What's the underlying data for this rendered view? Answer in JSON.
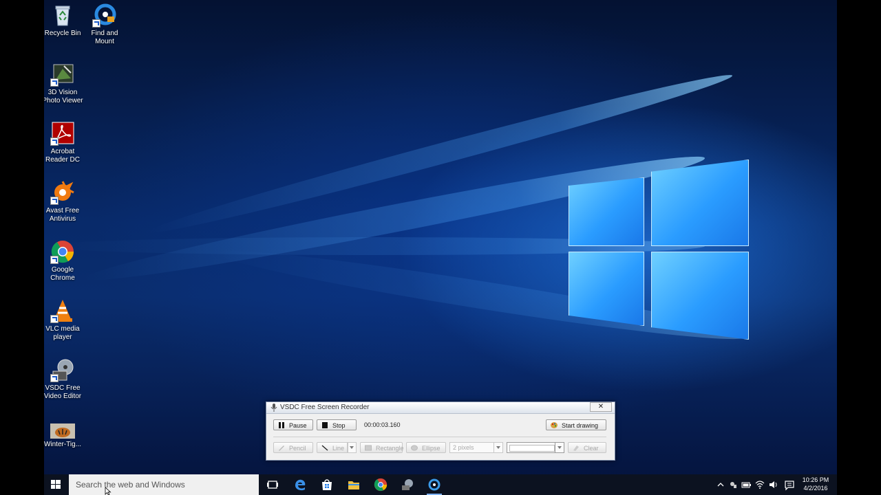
{
  "desktop_icons": [
    {
      "label": "Recycle Bin",
      "icon": "recycle-bin-icon"
    },
    {
      "label": "Find and\nMount",
      "icon": "find-and-mount-icon"
    },
    {
      "label": "3D Vision\nPhoto Viewer",
      "icon": "3d-vision-icon"
    },
    {
      "label": "Acrobat\nReader DC",
      "icon": "acrobat-icon"
    },
    {
      "label": "Avast Free\nAntivirus",
      "icon": "avast-icon"
    },
    {
      "label": "Google\nChrome",
      "icon": "chrome-icon"
    },
    {
      "label": "VLC media\nplayer",
      "icon": "vlc-icon"
    },
    {
      "label": "VSDC Free\nVideo Editor",
      "icon": "vsdc-editor-icon"
    },
    {
      "label": "Winter-Tig...",
      "icon": "image-thumbnail-icon"
    }
  ],
  "taskbar": {
    "search_placeholder": "Search the web and Windows",
    "clock_time": "10:26 PM",
    "clock_date": "4/2/2016"
  },
  "recorder": {
    "title": "VSDC Free Screen Recorder",
    "close_label": "✕",
    "pause_label": "Pause",
    "stop_label": "Stop",
    "timer": "00:00:03.160",
    "start_drawing_label": "Start drawing",
    "pencil_label": "Pencil",
    "line_label": "Line",
    "rectangle_label": "Rectangle",
    "ellipse_label": "Ellipse",
    "pixels_value": "2 pixels",
    "clear_label": "Clear"
  },
  "colors": {
    "accent": "#1a78e8",
    "taskbar": "#0c1220",
    "dialog_bg": "#f0f0f0"
  }
}
